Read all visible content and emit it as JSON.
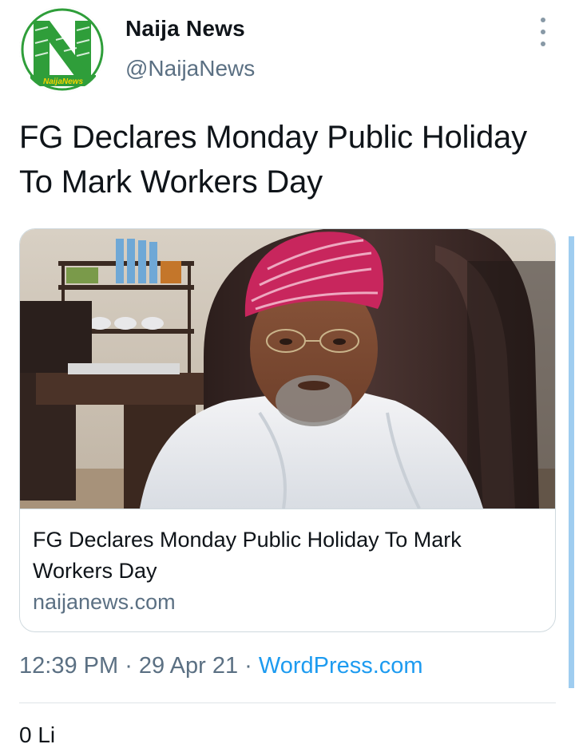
{
  "author": {
    "name": "Naija News",
    "handle": "@NaijaNews",
    "avatar_logo_text": "NaijaNews"
  },
  "tweet": {
    "text": "FG Declares Monday Public Holiday To Mark Workers Day"
  },
  "link_card": {
    "title": "FG Declares Monday Public Holiday To Mark Workers Day",
    "domain": "naijanews.com",
    "image_description": "photo"
  },
  "meta": {
    "time": "12:39 PM",
    "separator": " · ",
    "date": "29 Apr 21",
    "source": "WordPress.com"
  },
  "stats_partial": "0 Li",
  "icons": {
    "more": "more-vertical-icon"
  },
  "colors": {
    "brand_green": "#2f9e3a",
    "link_blue": "#1d9bf0",
    "secondary_text": "#5b7083",
    "border": "#cfd9de"
  }
}
